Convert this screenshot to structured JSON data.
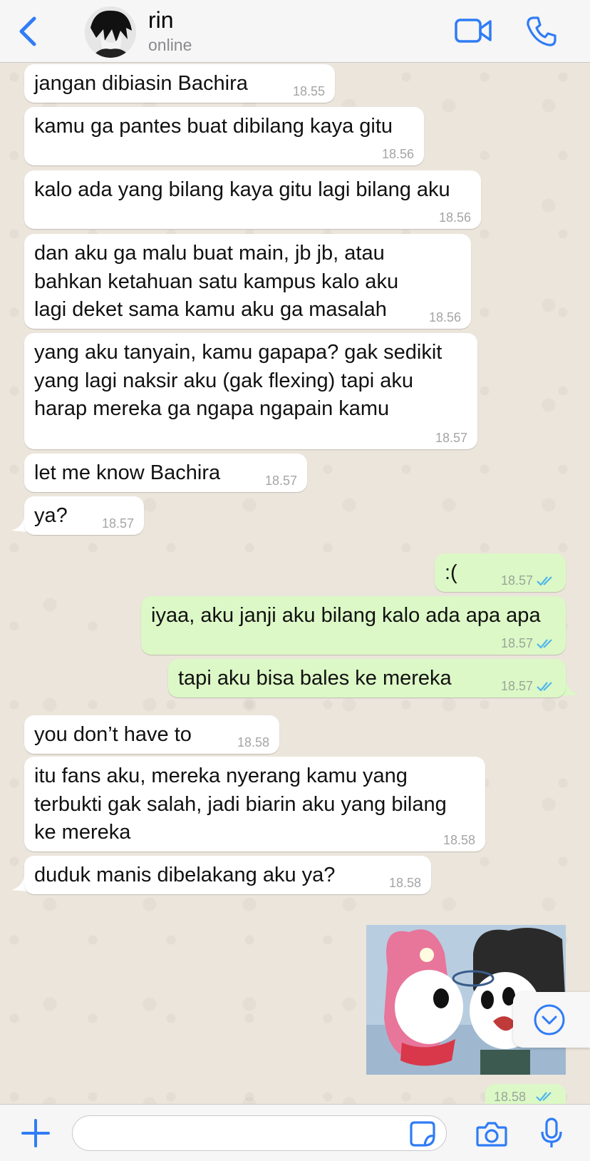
{
  "header": {
    "contact_name": "rin",
    "status": "online"
  },
  "messages": [
    {
      "dir": "in",
      "text": "jangan dibiasin Bachira",
      "time": "18.55"
    },
    {
      "dir": "in",
      "text": "kamu ga pantes buat dibilang kaya gitu",
      "time": "18.56"
    },
    {
      "dir": "in",
      "text": "kalo ada yang bilang kaya gitu lagi bilang aku",
      "time": "18.56"
    },
    {
      "dir": "in",
      "text": "dan aku ga malu buat main, jb jb, atau bahkan ketahuan satu kampus kalo aku lagi deket sama kamu aku ga masalah",
      "time": "18.56"
    },
    {
      "dir": "in",
      "text": "yang aku tanyain, kamu gapapa? gak sedikit yang lagi naksir aku (gak flexing) tapi aku harap mereka ga ngapa ngapain kamu",
      "time": "18.57"
    },
    {
      "dir": "in",
      "text": "let me know Bachira",
      "time": "18.57"
    },
    {
      "dir": "in",
      "text": "ya?",
      "time": "18.57"
    },
    {
      "dir": "out",
      "text": ":(",
      "time": "18.57"
    },
    {
      "dir": "out",
      "text": "iyaa, aku janji aku bilang kalo ada apa apa",
      "time": "18.57"
    },
    {
      "dir": "out",
      "text": "tapi aku bisa bales ke mereka",
      "time": "18.57"
    },
    {
      "dir": "in",
      "text": "you don’t have to",
      "time": "18.58"
    },
    {
      "dir": "in",
      "text": "itu fans aku, mereka nyerang kamu yang terbukti gak salah, jadi biarin aku yang bilang ke mereka",
      "time": "18.58"
    },
    {
      "dir": "in",
      "text": "duduk manis dibelakang aku ya?",
      "time": "18.58"
    }
  ],
  "sticker_time": "18.58",
  "composer": {
    "placeholder": "",
    "value": ""
  },
  "colors": {
    "accent": "#2f7cf6",
    "incoming_bubble": "#ffffff",
    "outgoing_bubble": "#dcf8c6",
    "read_ticks": "#4fb6ec"
  },
  "icons": [
    "back-chevron-icon",
    "video-call-icon",
    "phone-icon",
    "plus-icon",
    "sticker-icon",
    "camera-icon",
    "microphone-icon",
    "chevron-down-icon",
    "double-check-icon"
  ]
}
